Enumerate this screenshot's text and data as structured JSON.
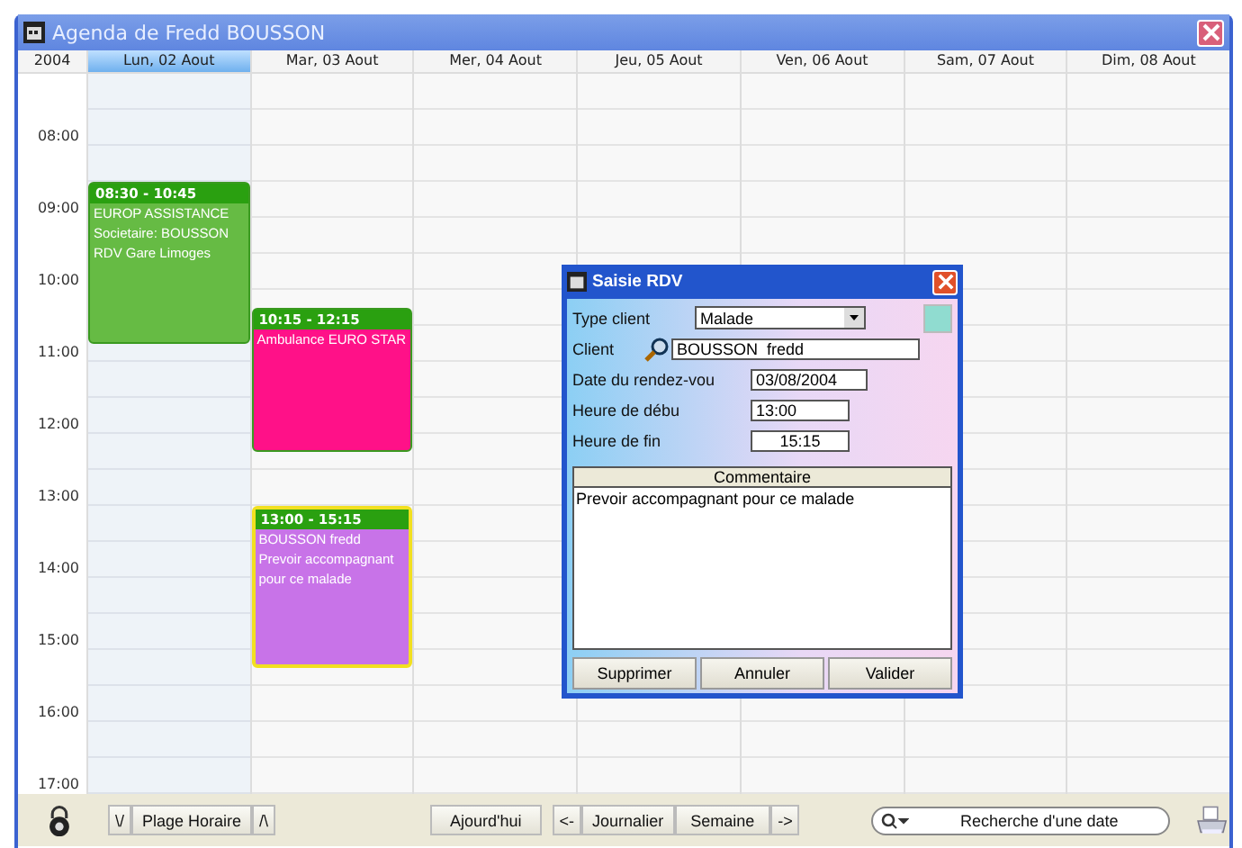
{
  "window": {
    "title": "Agenda de Fredd BOUSSON"
  },
  "calendar": {
    "year": "2004",
    "days": [
      {
        "label": "Lun, 02 Aout",
        "selected": true,
        "events": [
          {
            "time": "08:30 - 10:45",
            "lines": [
              "EUROP ASSISTANCE",
              "Societaire: BOUSSON",
              "RDV Gare Limoges"
            ],
            "color": "#66bb44",
            "selected": false
          }
        ]
      },
      {
        "label": "Mar, 03 Aout",
        "selected": false,
        "events": [
          {
            "time": "10:15 - 12:15",
            "lines": [
              "Ambulance EURO STAR"
            ],
            "color": "#ff1188",
            "selected": false
          },
          {
            "time": "13:00 - 15:15",
            "lines": [
              "BOUSSON  fredd",
              "Prevoir accompagnant",
              "pour ce malade"
            ],
            "color": "#c873e8",
            "selected": true
          }
        ]
      },
      {
        "label": "Mer, 04 Aout",
        "selected": false
      },
      {
        "label": "Jeu, 05 Aout",
        "selected": false
      },
      {
        "label": "Ven, 06 Aout",
        "selected": false
      },
      {
        "label": "Sam, 07 Aout",
        "selected": false
      },
      {
        "label": "Dim, 08 Aout",
        "selected": false
      }
    ],
    "hours": [
      "08:00",
      "09:00",
      "10:00",
      "11:00",
      "12:00",
      "13:00",
      "14:00",
      "15:00",
      "16:00",
      "17:00"
    ]
  },
  "dialog": {
    "title": "Saisie RDV",
    "type_client": {
      "label": "Type client",
      "value": "Malade"
    },
    "client": {
      "label": "Client",
      "value": "BOUSSON  fredd"
    },
    "date": {
      "label": "Date du rendez-vou",
      "value": "03/08/2004"
    },
    "start": {
      "label": "Heure de débu",
      "value": "13:00"
    },
    "end": {
      "label": "Heure de fin",
      "value": "15:15"
    },
    "comment": {
      "label": "Commentaire",
      "value": "Prevoir accompagnant pour ce malade"
    },
    "buttons": [
      "Supprimer",
      "Annuler",
      "Valider"
    ]
  },
  "toolbar": {
    "range_down": "\\/",
    "range_label": "Plage Horaire",
    "range_up": "/\\",
    "today": "Ajourd'hui",
    "prev": "<-",
    "daily": "Journalier",
    "weekly": "Semaine",
    "next": "->",
    "search": {
      "placeholder": "Recherche d'une date"
    }
  }
}
